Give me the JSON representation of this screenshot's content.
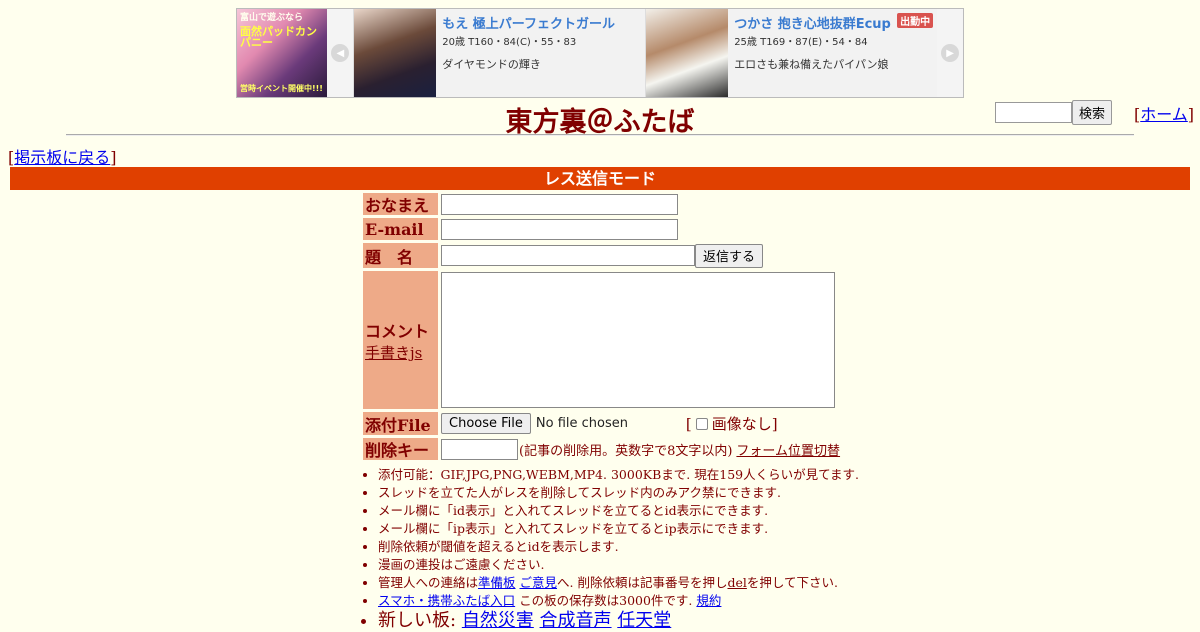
{
  "banner": {
    "logo": {
      "line1": "富山で遊ぶなら",
      "line2": "面然パッドカンパニー",
      "line3": "営時イベント開催中!!!"
    },
    "prev_arrow": "◀",
    "next_arrow": "▶",
    "cards": [
      {
        "name": "もえ 極上パーフェクトガール",
        "stats": "20歳 T160・84(C)・55・83",
        "desc": "ダイヤモンドの輝き"
      },
      {
        "name": "つかさ 抱き心地抜群Ecup",
        "stats": "25歳 T169・87(E)・54・84",
        "desc": "エロさも兼ね備えたパイパン娘",
        "badge": "出勤中"
      }
    ]
  },
  "header": {
    "title": "東方裏＠ふたば",
    "search_button": "検索",
    "home_link": "ホーム",
    "back_link": "掲示板に戻る"
  },
  "mode_bar": "レス送信モード",
  "form": {
    "name_label": "おなまえ",
    "email_label": "E-mail",
    "subject_label": "題　名",
    "submit_label": "返信する",
    "comment_label": "コメント",
    "tegaki_link": "手書きjs",
    "file_label": "添付File",
    "file_button": "Choose File",
    "file_status": "No file chosen",
    "noimg_label": "画像なし",
    "delkey_label": "削除キー",
    "delkey_note": "(記事の削除用。英数字で8文字以内)",
    "form_toggle_link": "フォーム位置切替"
  },
  "rules": {
    "r1": "添付可能：GIF,JPG,PNG,WEBM,MP4. 3000KBまで. 現在159人くらいが見てます.",
    "r2": "スレッドを立てた人がレスを削除してスレッド内のみアク禁にできます.",
    "r3": "メール欄に「id表示」と入れてスレッドを立てるとid表示にできます.",
    "r4": "メール欄に「ip表示」と入れてスレッドを立てるとip表示にできます.",
    "r5": "削除依頼が閾値を超えるとidを表示します.",
    "r6": "漫画の連投はご遠慮ください.",
    "r7_pre": "管理人への連絡は",
    "r7_link1": "準備板",
    "r7_link2": "ご意見",
    "r7_mid": "へ. 削除依頼は記事番号を押し",
    "r7_link3": "del",
    "r7_post": "を押して下さい.",
    "r8_link": "スマホ・携帯ふたば入口",
    "r8_mid": "この板の保存数は3000件です.",
    "r8_link2": "規約",
    "r9_pre": "新しい板:",
    "r9_links": [
      "自然災害",
      "合成音声",
      "任天堂"
    ]
  }
}
